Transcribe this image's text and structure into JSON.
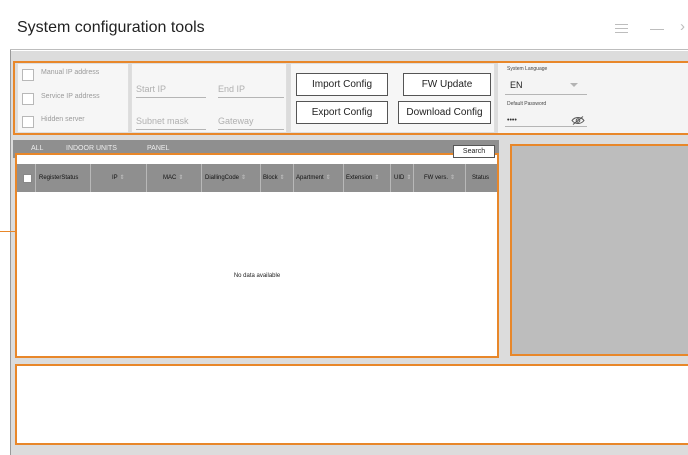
{
  "window": {
    "title": "System configuration tools"
  },
  "window_controls": {
    "menu_icon": "hamburger-icon",
    "minimize_icon": "minimize-icon",
    "close_glyph": "›"
  },
  "options": {
    "manual_ip": "Manual IP address",
    "service_ip": "Service IP address",
    "hidden_server": "Hidden server"
  },
  "ip_fields": {
    "start_ip": "Start IP",
    "end_ip": "End IP",
    "subnet_mask": "Subnet mask",
    "gateway": "Gateway"
  },
  "buttons": {
    "import_config": "Import Config",
    "fw_update": "FW Update",
    "export_config": "Export Config",
    "download_config": "Download Config"
  },
  "settings": {
    "language_label": "System Language",
    "language_value": "EN",
    "password_label": "Default Password",
    "password_value": "••••"
  },
  "tabs": [
    "ALL",
    "INDOOR UNITS",
    "PANEL"
  ],
  "search_label": "Search",
  "table": {
    "columns": [
      "RegisterStatus",
      "IP",
      "MAC",
      "DiallingCode",
      "Block",
      "Apartment",
      "Extension",
      "UID",
      "FW vers.",
      "Status"
    ],
    "empty_text": "No data available"
  },
  "colors": {
    "highlight": "#e8872a",
    "header_grey": "#8f8f8f",
    "panel_grey": "#bdbdbd"
  }
}
